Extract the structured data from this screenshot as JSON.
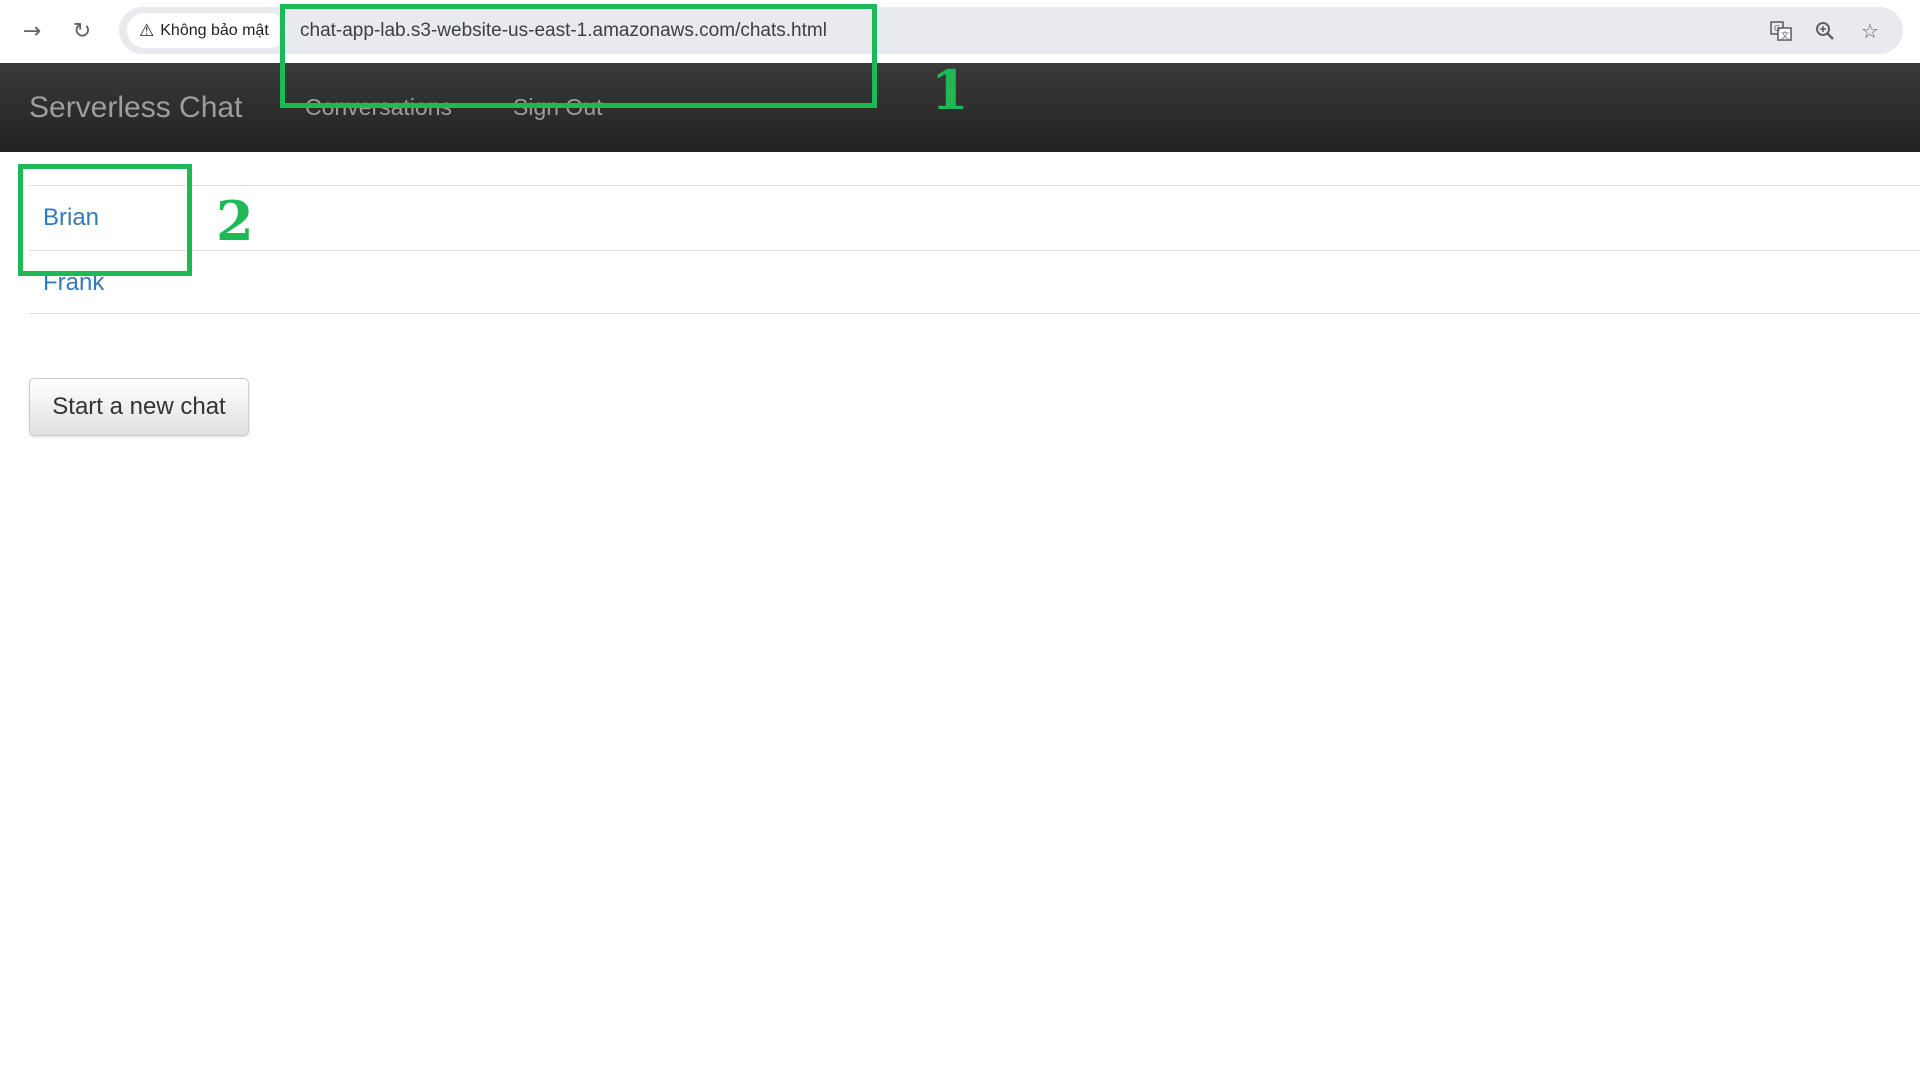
{
  "browser": {
    "back_icon": "arrow-right-icon",
    "reload_icon": "reload-icon",
    "security_label": "Không bảo mật",
    "url": "chat-app-lab.s3-website-us-east-1.amazonaws.com/chats.html",
    "translate_icon": "translate-icon",
    "zoom_icon": "zoom-icon",
    "bookmark_icon": "star-icon"
  },
  "navbar": {
    "brand": "Serverless Chat",
    "links": [
      "Conversations",
      "Sign Out"
    ]
  },
  "conversations": [
    {
      "name": "Brian"
    },
    {
      "name": "Frank"
    }
  ],
  "new_chat_button": "Start a new chat",
  "annotations": {
    "labels": [
      "1",
      "2"
    ],
    "color": "#1db954"
  }
}
